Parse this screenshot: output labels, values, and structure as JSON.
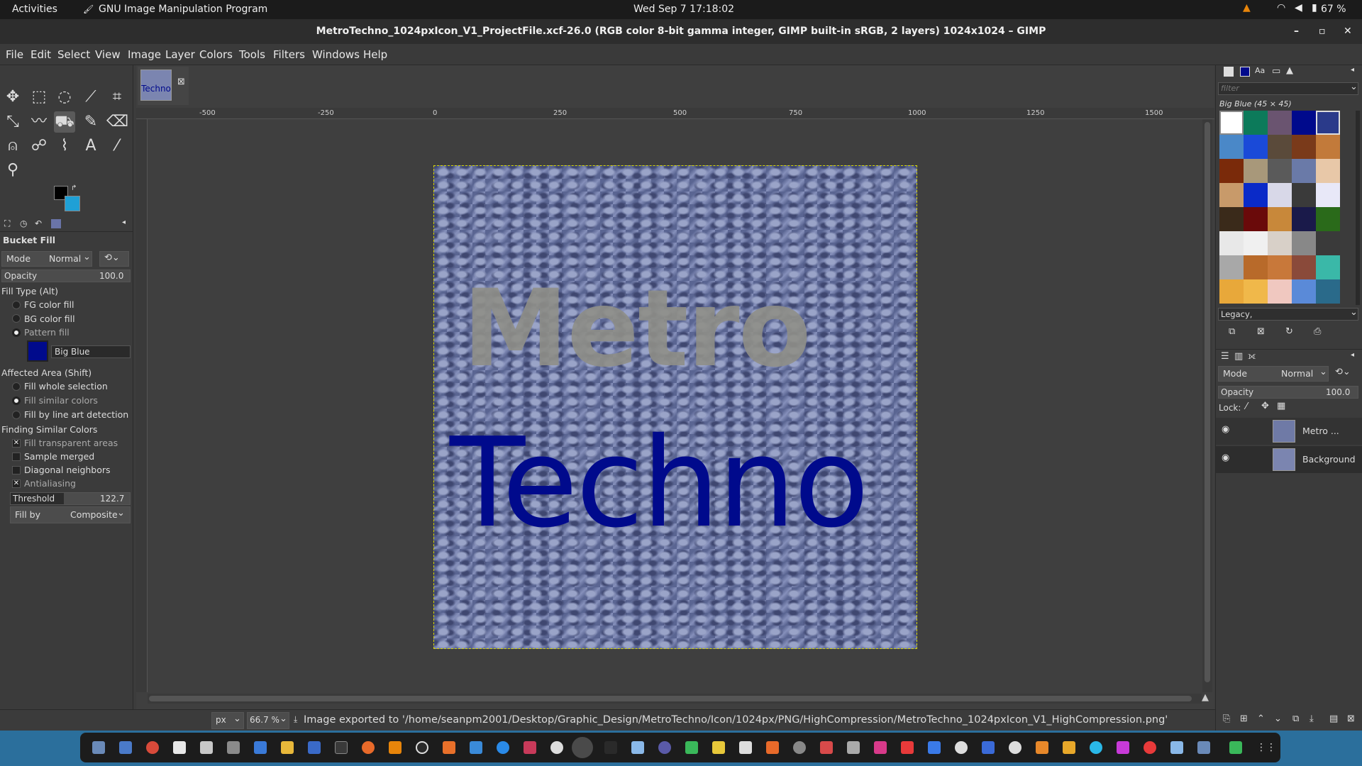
{
  "topbar": {
    "activities": "Activities",
    "app_name": "GNU Image Manipulation Program",
    "clock": "Wed Sep 7  17:18:02",
    "battery": "67 %"
  },
  "window": {
    "title": "MetroTechno_1024pxIcon_V1_ProjectFile.xcf-26.0 (RGB color 8-bit gamma integer, GIMP built-in sRGB, 2 layers) 1024x1024 – GIMP"
  },
  "menu": [
    "File",
    "Edit",
    "Select",
    "View",
    "Image",
    "Layer",
    "Colors",
    "Tools",
    "Filters",
    "Windows",
    "Help"
  ],
  "image_tab": {
    "thumb_text": "Techno"
  },
  "tool_options": {
    "title": "Bucket Fill",
    "mode_label": "Mode",
    "mode_value": "Normal",
    "opacity_label": "Opacity",
    "opacity_value": "100.0",
    "fill_type_label": "Fill Type  (Alt)",
    "fill_types": [
      "FG color fill",
      "BG color fill",
      "Pattern fill"
    ],
    "pattern_name": "Big Blue",
    "affected_label": "Affected Area  (Shift)",
    "affected": [
      "Fill whole selection",
      "Fill similar colors",
      "Fill by line art detection"
    ],
    "finding_label": "Finding Similar Colors",
    "finding": [
      "Fill transparent areas",
      "Sample merged",
      "Diagonal neighbors",
      "Antialiasing"
    ],
    "threshold_label": "Threshold",
    "threshold_value": "122.7",
    "fillby_label": "Fill by",
    "fillby_value": "Composite"
  },
  "ruler": {
    "labels": [
      "-500",
      "-250",
      "0",
      "250",
      "500",
      "750",
      "1000",
      "1250",
      "1500"
    ]
  },
  "canvas": {
    "text_metro": "Metro",
    "text_techno": "Techno"
  },
  "patterns": {
    "filter_placeholder": "filter",
    "title": "Big Blue (45 × 45)",
    "tag": "Legacy,"
  },
  "layers": {
    "mode_label": "Mode",
    "mode_value": "Normal",
    "opacity_label": "Opacity",
    "opacity_value": "100.0",
    "lock_label": "Lock:",
    "items": [
      "Metro ...",
      "Background"
    ]
  },
  "status": {
    "unit": "px",
    "zoom": "66.7 %",
    "message": "Image exported to '/home/seanpm2001/Desktop/Graphic_Design/MetroTechno/Icon/1024px/PNG/HighCompression/MetroTechno_1024pxIcon_V1_HighCompression.png'"
  },
  "colors": {
    "accent_blue": "#000a8c",
    "fg": "#000000",
    "bg": "#1fa0d6"
  }
}
